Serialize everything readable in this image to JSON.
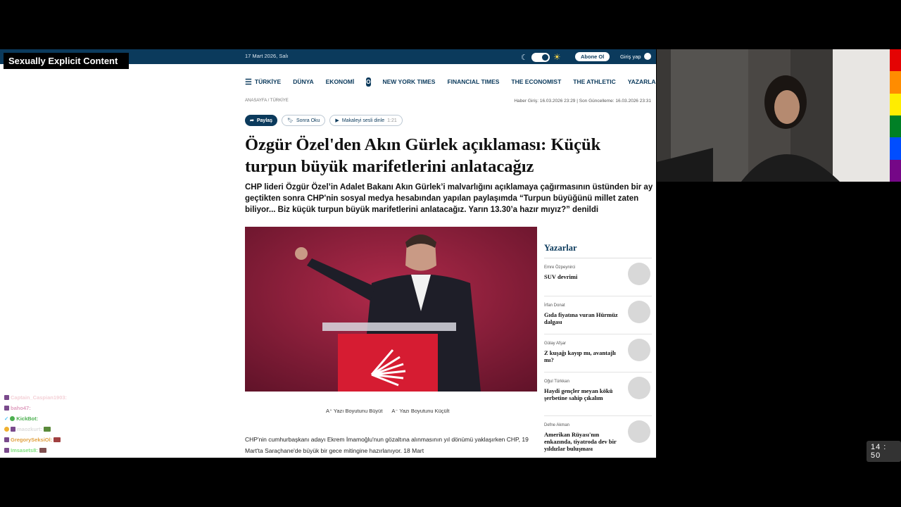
{
  "overlay": {
    "warning": "Sexually Explicit Content",
    "clock": "14 : 50"
  },
  "topbar": {
    "date": "17 Mart 2026, Salı",
    "subscribe": "Abone Ol",
    "login": "Giriş yap"
  },
  "nav": {
    "items": [
      "TÜRKİYE",
      "DÜNYA",
      "EKONOMİ",
      "NEW YORK TIMES",
      "FINANCIAL TIMES",
      "THE ECONOMIST",
      "THE ATHLETIC",
      "YAZARLAR"
    ],
    "logo": "O"
  },
  "article": {
    "breadcrumb": "ANASAYFA / TÜRKİYE",
    "updated": "Haber Giriş: 16.03.2026 23:29 | Son Güncelleme: 16.03.2026 23:31",
    "share": "Paylaş",
    "read_later": "Sonra Oku",
    "listen": "Makaleyi sesli dinle",
    "listen_duration": "1:21",
    "headline": "Özgür Özel'den Akın Gürlek açıklaması: Küçük turpun büyük marifetlerini anlatacağız",
    "lead": "CHP lideri Özgür Özel’in Adalet Bakanı Akın Gürlek’i malvarlığını açıklamaya çağırmasının üstünden bir ay geçtikten sonra CHP'nin sosyal medya hesabından yapılan paylaşımda “Turpun büyüğünü millet zaten biliyor... Biz küçük turpun büyük marifetlerini anlatacağız. Yarın 13.30’a hazır mıyız?” denildi",
    "font_bigger": "A⁺ Yazı Boyutunu Büyüt",
    "font_smaller": "A⁻ Yazı Boyutunu Küçült",
    "body": "CHP'nin cumhurbaşkanı adayı Ekrem İmamoğlu'nun gözaltına alınmasının yıl dönümü yaklaşırken CHP, 19 Mart'ta Saraçhane'de büyük bir gece mitingine hazırlanıyor. 18 Mart"
  },
  "sidebar": {
    "title": "Yazarlar",
    "authors": [
      {
        "name": "Emre Özpeynirci",
        "title": "SUV devrimi"
      },
      {
        "name": "İrfan Donat",
        "title": "Gıda fiyatına vuran Hürmüz dalgası"
      },
      {
        "name": "Gülay Afşar",
        "title": "Z kuşağı kayıp mı, avantajlı mı?"
      },
      {
        "name": "Oğul Türkkan",
        "title": "Haydi gençler meyan kökü şerbetine sahip çıkalım"
      },
      {
        "name": "Defne Akman",
        "title": "Amerikan Rüyası'nın enkazında, tiyatroda dev bir yıldızlar buluşması"
      }
    ]
  },
  "chat": [
    {
      "user": "Captain_Caspian1903:",
      "color": "#e07a8c"
    },
    {
      "user": "baho47:",
      "color": "#e0a0c0"
    },
    {
      "user": "KickBot:",
      "color": "#4caf50"
    },
    {
      "user": "maozkurt:",
      "color": "#dddddd"
    },
    {
      "user": "GregorySeksiOl:",
      "color": "#e08080"
    },
    {
      "user": "Imsasets8:",
      "color": "#7ee07e"
    }
  ],
  "colors": {
    "brand": "#0b3a5c",
    "rainbow": [
      "#e40303",
      "#ff8c00",
      "#ffed00",
      "#008026",
      "#004dff",
      "#750787"
    ]
  }
}
